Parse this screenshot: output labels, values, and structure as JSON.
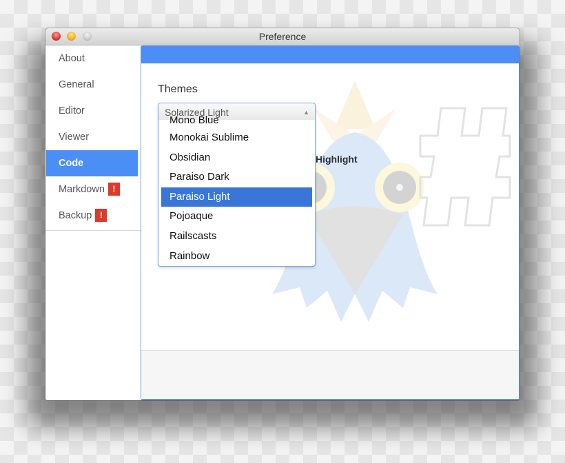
{
  "window": {
    "title": "Preference",
    "controls": [
      "close",
      "minimize",
      "zoom"
    ]
  },
  "sidebar": {
    "items": [
      {
        "label": "About",
        "active": false,
        "badge": null
      },
      {
        "label": "General",
        "active": false,
        "badge": null
      },
      {
        "label": "Editor",
        "active": false,
        "badge": null
      },
      {
        "label": "Viewer",
        "active": false,
        "badge": null
      },
      {
        "label": "Code",
        "active": true,
        "badge": null
      },
      {
        "label": "Markdown",
        "active": false,
        "badge": "!"
      },
      {
        "label": "Backup",
        "active": false,
        "badge": "!"
      }
    ]
  },
  "main": {
    "section_label": "Themes",
    "background_label": "Highlight",
    "theme_select": {
      "selected": "Solarized Light",
      "arrow_icon": "up-triangle",
      "options": [
        "Mono Blue",
        "Monokai Sublime",
        "Obsidian",
        "Paraiso Dark",
        "Paraiso Light",
        "Pojoaque",
        "Railscasts",
        "Rainbow"
      ],
      "highlighted": "Paraiso Light"
    }
  },
  "colors": {
    "accent": "#4a8ef6",
    "highlight": "#3a76d8",
    "badge": "#db3b2b"
  }
}
